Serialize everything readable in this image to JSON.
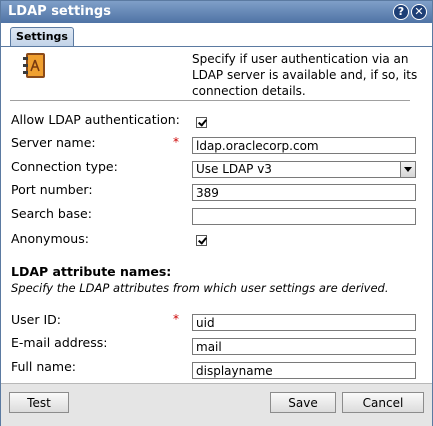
{
  "window": {
    "title": "LDAP settings",
    "help_icon": "help-icon",
    "close_icon": "close-icon"
  },
  "tabs": [
    {
      "label": "Settings",
      "active": true
    }
  ],
  "intro": {
    "icon": "address-book-icon",
    "text": "Specify if user authentication via an LDAP server is available and, if so, its connection details."
  },
  "form": {
    "allow_ldap": {
      "label": "Allow LDAP authentication:",
      "checked": true
    },
    "server_name": {
      "label": "Server name:",
      "required_mark": "*",
      "value": "ldap.oraclecorp.com"
    },
    "connection_type": {
      "label": "Connection type:",
      "value": "Use LDAP v3"
    },
    "port_number": {
      "label": "Port number:",
      "value": "389"
    },
    "search_base": {
      "label": "Search base:",
      "value": ""
    },
    "anonymous": {
      "label": "Anonymous:",
      "checked": true
    }
  },
  "attributes": {
    "title": "LDAP attribute names:",
    "description": "Specify the LDAP attributes from which user settings are derived.",
    "user_id": {
      "label": "User ID:",
      "required_mark": "*",
      "value": "uid"
    },
    "email": {
      "label": "E-mail address:",
      "value": "mail"
    },
    "full_name": {
      "label": "Full name:",
      "value": "displayname"
    }
  },
  "buttons": {
    "test": "Test",
    "save": "Save",
    "cancel": "Cancel"
  },
  "colors": {
    "title_bar": "#4f73a5",
    "required": "#cc0000"
  }
}
